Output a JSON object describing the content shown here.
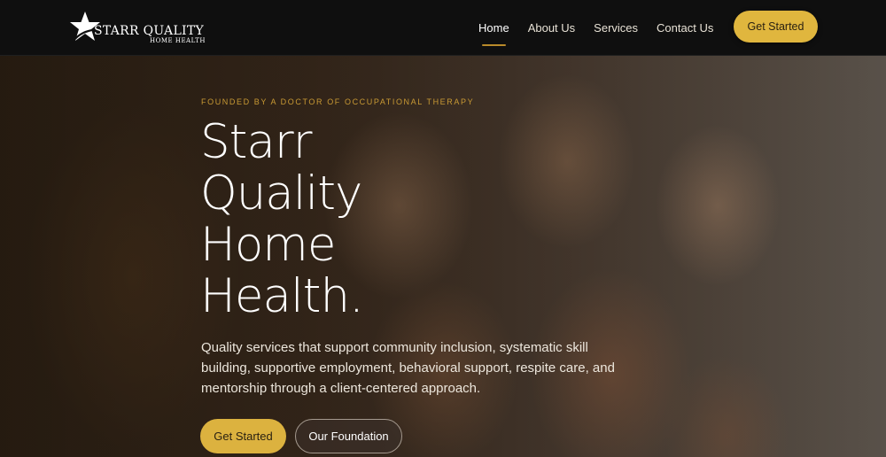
{
  "brand": {
    "title": "STARR QUALITY",
    "subtitle": "HOME HEALTH",
    "logo_icon": "star-icon"
  },
  "nav": {
    "items": [
      {
        "label": "Home",
        "active": true
      },
      {
        "label": "About Us",
        "active": false
      },
      {
        "label": "Services",
        "active": false
      },
      {
        "label": "Contact Us",
        "active": false
      }
    ],
    "cta_label": "Get Started"
  },
  "hero": {
    "eyebrow": "FOUNDED BY A DOCTOR OF OCCUPATIONAL THERAPY",
    "headline_lines": [
      "Starr",
      "Quality",
      "Home",
      "Health."
    ],
    "description": "Quality services that support community inclusion, systematic skill building, supportive employment, behavioral support, respite care, and mentorship through a client-centered approach.",
    "primary_button": "Get Started",
    "secondary_button": "Our Foundation"
  },
  "colors": {
    "accent": "#dcb23f",
    "header_bg": "#0f0f0f",
    "eyebrow": "#c99a34"
  }
}
